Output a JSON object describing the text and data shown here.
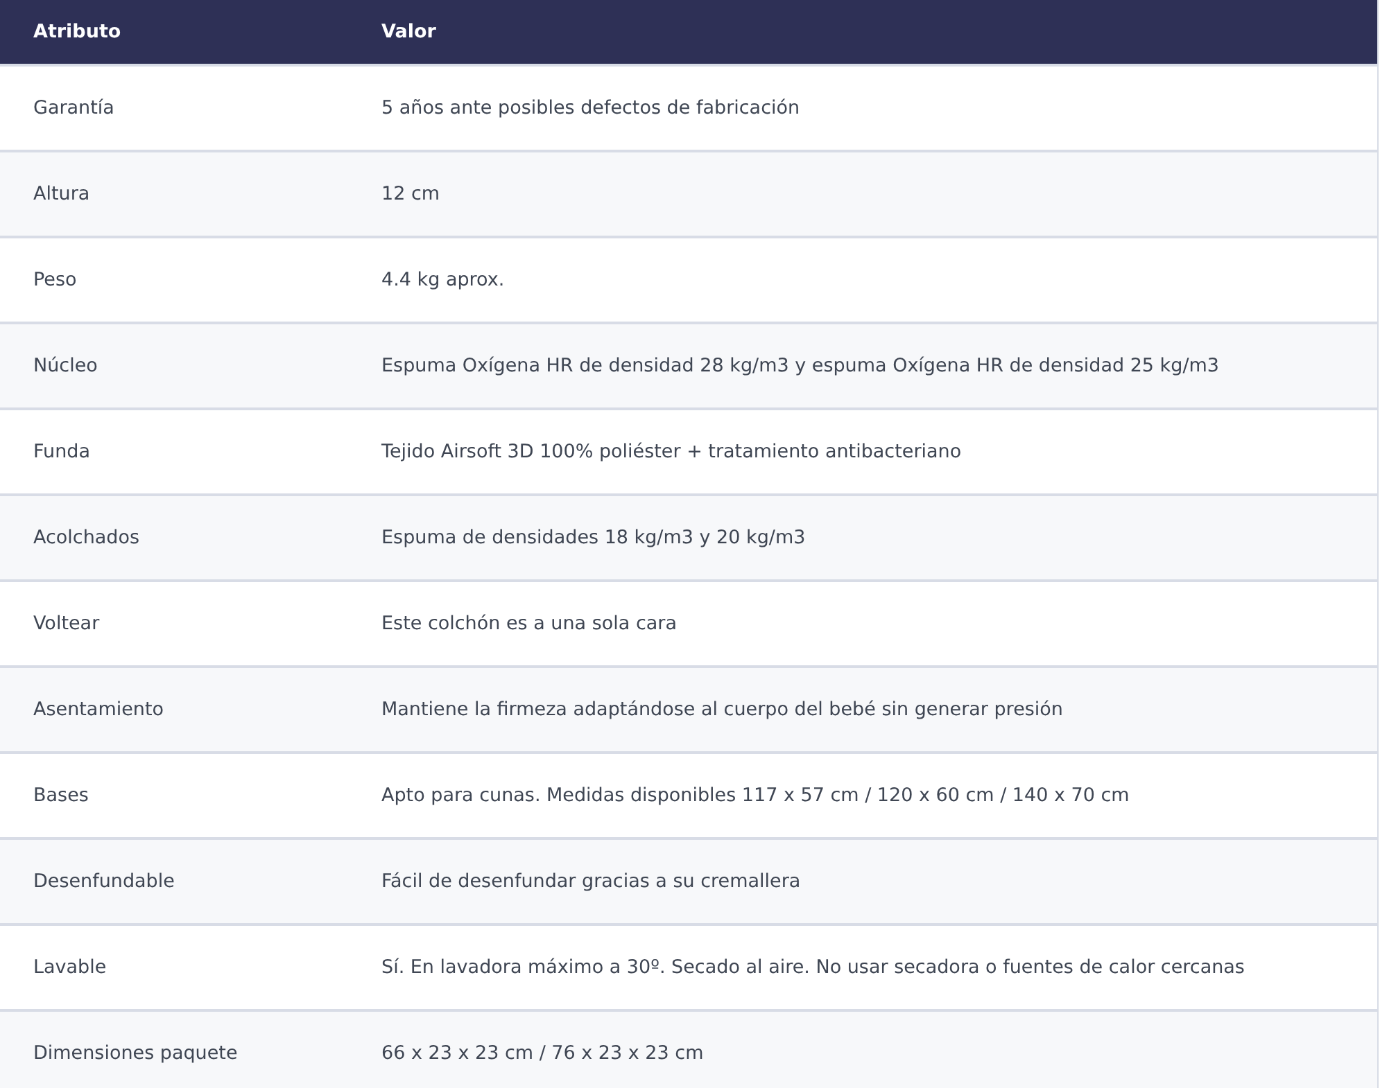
{
  "table": {
    "columns": [
      "Atributo",
      "Valor"
    ],
    "rows": [
      {
        "attribute": "Garantía",
        "value": "5 años ante posibles defectos de fabricación"
      },
      {
        "attribute": "Altura",
        "value": "12 cm"
      },
      {
        "attribute": "Peso",
        "value": "4.4 kg aprox."
      },
      {
        "attribute": "Núcleo",
        "value": "Espuma Oxígena HR de densidad 28 kg/m3 y espuma Oxígena HR de densidad 25 kg/m3"
      },
      {
        "attribute": "Funda",
        "value": "Tejido Airsoft 3D 100% poliéster + tratamiento antibacteriano"
      },
      {
        "attribute": "Acolchados",
        "value": "Espuma de densidades 18 kg/m3 y 20 kg/m3"
      },
      {
        "attribute": "Voltear",
        "value": "Este colchón es a una sola cara"
      },
      {
        "attribute": "Asentamiento",
        "value": "Mantiene la firmeza adaptándose al cuerpo del bebé sin generar presión"
      },
      {
        "attribute": "Bases",
        "value": "Apto para cunas. Medidas disponibles 117 x 57 cm / 120 x 60 cm / 140 x 70 cm"
      },
      {
        "attribute": "Desenfundable",
        "value": "Fácil de desenfundar gracias a su cremallera"
      },
      {
        "attribute": "Lavable",
        "value": "Sí. En lavadora máximo a 30º. Secado al aire. No usar secadora o fuentes de calor cercanas"
      },
      {
        "attribute": "Dimensiones paquete",
        "value": "66 x 23 x 23 cm / 76 x 23 x 23 cm"
      }
    ]
  }
}
